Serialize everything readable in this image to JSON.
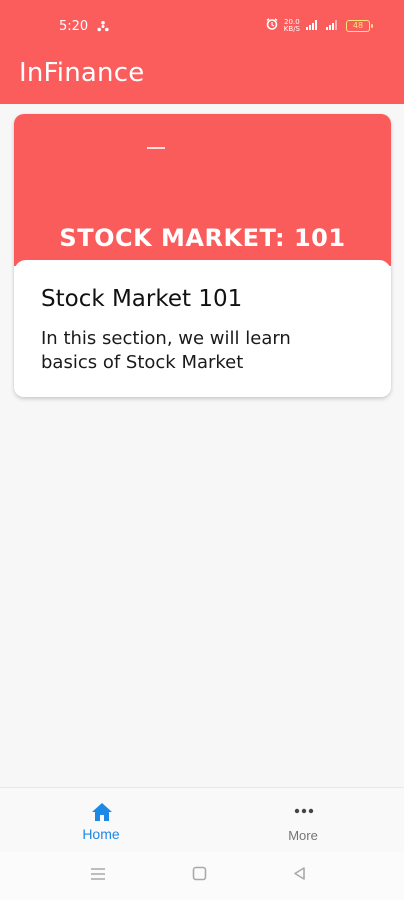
{
  "status_bar": {
    "time": "5:20",
    "network_speed": "20.0\nKB/S",
    "battery": "48"
  },
  "app_bar": {
    "title": "InFinance"
  },
  "card": {
    "banner_text": "STOCK MARKET: 101",
    "title": "Stock Market 101",
    "description": "In this section, we will learn basics of Stock Market"
  },
  "bottom_nav": {
    "items": [
      {
        "label": "Home",
        "icon": "home-icon",
        "active": true
      },
      {
        "label": "More",
        "icon": "more-horizontal-icon",
        "active": false
      }
    ]
  },
  "colors": {
    "primary": "#fb5c5c",
    "active_tab": "#1e88e5",
    "inactive_tab": "#757575"
  }
}
